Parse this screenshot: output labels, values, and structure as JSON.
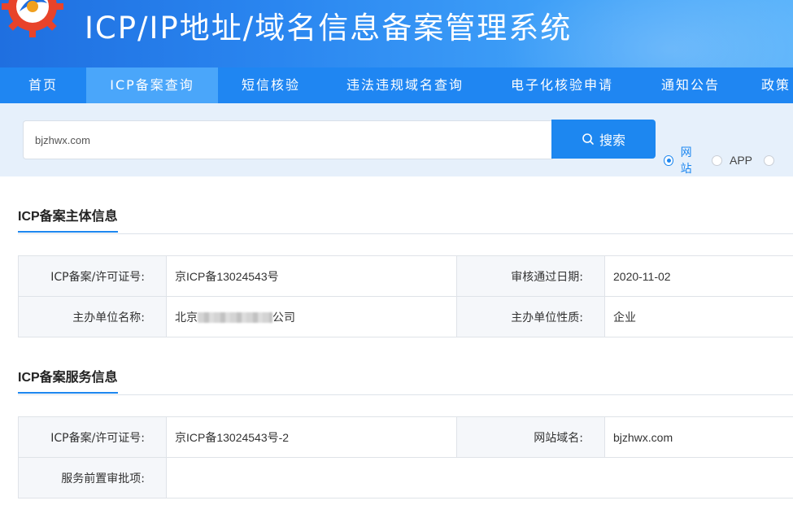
{
  "header": {
    "title": "ICP/IP地址/域名信息备案管理系统",
    "logo_icon": "gear-logo-icon"
  },
  "nav": {
    "items": [
      {
        "label": "首页"
      },
      {
        "label": "ICP备案查询"
      },
      {
        "label": "短信核验"
      },
      {
        "label": "违法违规域名查询"
      },
      {
        "label": "电子化核验申请"
      },
      {
        "label": "通知公告"
      },
      {
        "label": "政策"
      }
    ],
    "active_index": 1
  },
  "search": {
    "value": "bjzhwx.com",
    "button_label": "搜索",
    "types": [
      {
        "label": "网站",
        "checked": true
      },
      {
        "label": "APP",
        "checked": false
      },
      {
        "label": "",
        "checked": false
      }
    ]
  },
  "subject_section": {
    "title": "ICP备案主体信息",
    "rows": [
      {
        "l1": "ICP备案/许可证号:",
        "v1": "京ICP备13024543号",
        "l2": "审核通过日期:",
        "v2": "2020-11-02"
      },
      {
        "l1": "主办单位名称:",
        "v1_prefix": "北京",
        "v1_suffix": "公司",
        "l2": "主办单位性质:",
        "v2": "企业"
      }
    ]
  },
  "service_section": {
    "title": "ICP备案服务信息",
    "rows": [
      {
        "l1": "ICP备案/许可证号:",
        "v1": "京ICP备13024543号-2",
        "l2": "网站域名:",
        "v2": "bjzhwx.com"
      },
      {
        "l1": "服务前置审批项:",
        "v1": ""
      }
    ]
  },
  "colors": {
    "primary": "#1d87f0",
    "nav_bg": "#1f86f2",
    "nav_active": "#4aa6fa",
    "search_bg": "#e6f0fb"
  }
}
